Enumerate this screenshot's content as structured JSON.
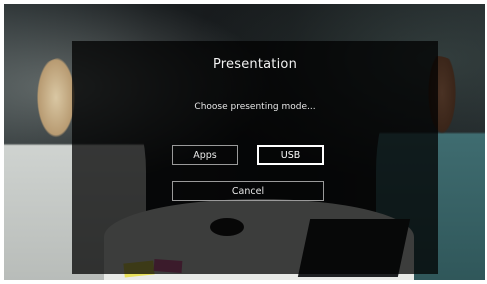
{
  "dialog": {
    "title": "Presentation",
    "prompt": "Choose presenting mode...",
    "buttons": {
      "apps": "Apps",
      "usb": "USB",
      "cancel": "Cancel"
    },
    "selected": "USB"
  }
}
